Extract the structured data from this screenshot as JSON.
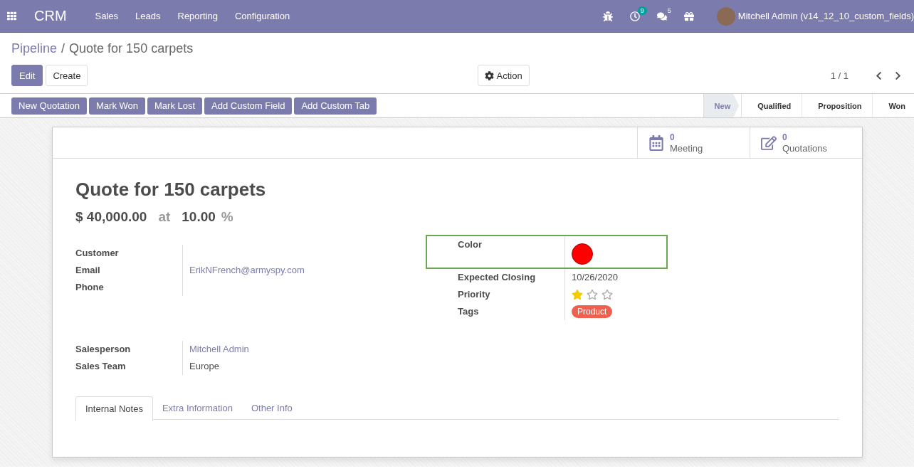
{
  "navbar": {
    "app_name": "CRM",
    "menus": [
      "Sales",
      "Leads",
      "Reporting",
      "Configuration"
    ],
    "activity_count": "9",
    "message_count": "5",
    "user": "Mitchell Admin (v14_12_10_custom_fields)"
  },
  "breadcrumb": {
    "parent": "Pipeline",
    "separator": "/",
    "current": "Quote for 150 carpets"
  },
  "control_panel": {
    "edit": "Edit",
    "create": "Create",
    "action": "Action",
    "pager": "1 / 1"
  },
  "header_buttons": [
    "New Quotation",
    "Mark Won",
    "Mark Lost",
    "Add Custom Field",
    "Add Custom Tab"
  ],
  "stages": [
    {
      "label": "New",
      "selected": true
    },
    {
      "label": "Qualified",
      "selected": false
    },
    {
      "label": "Proposition",
      "selected": false
    },
    {
      "label": "Won",
      "selected": false
    }
  ],
  "smart_buttons": [
    {
      "kind": "calendar",
      "count": "0",
      "label": "Meeting"
    },
    {
      "kind": "edit",
      "count": "0",
      "label": "Quotations"
    }
  ],
  "title": "Quote for 150 carpets",
  "revenue": {
    "amount": "$ 40,000.00",
    "at": "at",
    "probability": "10.00",
    "percent": "%"
  },
  "contact_fields": [
    {
      "label": "Customer",
      "kind": "text"
    },
    {
      "label": "Email",
      "kind": "link",
      "value": "ErikNFrench@armyspy.com"
    },
    {
      "label": "Phone",
      "kind": "text"
    }
  ],
  "detail_fields": [
    {
      "label": "Color",
      "kind": "color",
      "color": "#ff0000",
      "highlighted": true
    },
    {
      "label": "Expected Closing",
      "kind": "text",
      "value": "10/26/2020",
      "highlighted": false
    },
    {
      "label": "Priority",
      "kind": "stars",
      "stars": 1,
      "highlighted": false
    },
    {
      "label": "Tags",
      "kind": "tags",
      "tags": [
        {
          "label": "Product",
          "color": "#f06050"
        }
      ],
      "highlighted": false
    }
  ],
  "sales_fields": [
    {
      "label": "Salesperson",
      "kind": "link",
      "value": "Mitchell Admin"
    },
    {
      "label": "Sales Team",
      "kind": "text",
      "value": "Europe"
    }
  ],
  "notebook_tabs": [
    {
      "label": "Internal Notes",
      "selected": true
    },
    {
      "label": "Extra Information",
      "selected": false
    },
    {
      "label": "Other Info",
      "selected": false
    }
  ]
}
